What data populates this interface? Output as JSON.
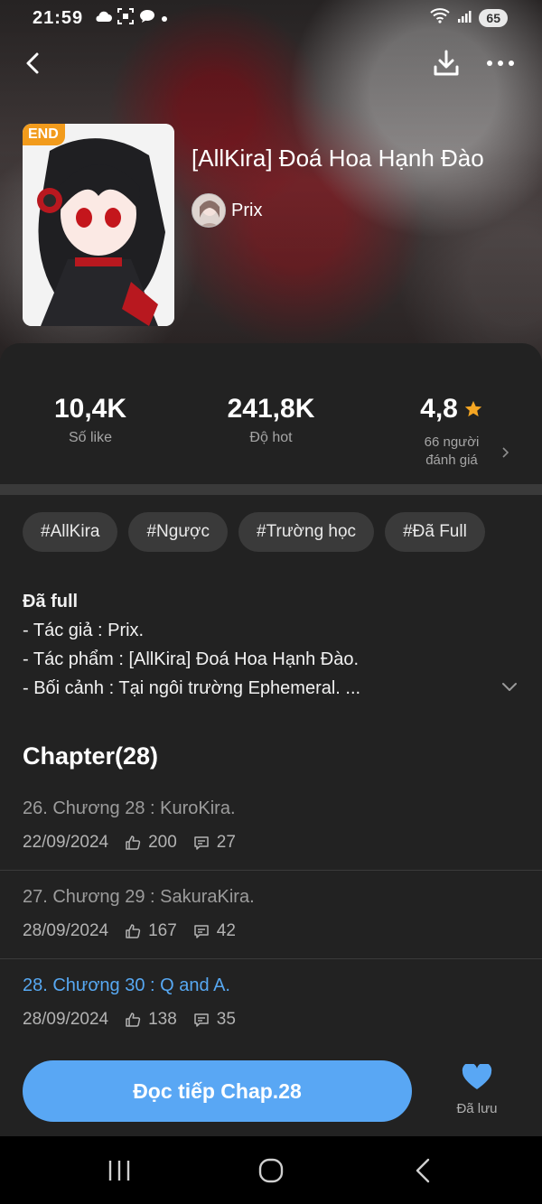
{
  "status_bar": {
    "time": "21:59",
    "battery": "65",
    "icons": [
      "cloud-icon",
      "screenshot-icon",
      "chat-bubble-icon",
      "dot-icon",
      "wifi-icon",
      "signal-icon",
      "battery-icon"
    ]
  },
  "app_bar": {
    "back_icon": "chevron-left-icon",
    "download_icon": "download-icon",
    "more_icon": "more-dots-icon"
  },
  "story": {
    "badge": "END",
    "title": "[AllKira] Đoá Hoa Hạnh Đào",
    "author": "Prix"
  },
  "stats": {
    "likes": {
      "value": "10,4K",
      "label": "Số like"
    },
    "hot": {
      "value": "241,8K",
      "label": "Độ hot"
    },
    "rating": {
      "value": "4,8",
      "label_line1": "66 người",
      "label_line2": "đánh giá"
    }
  },
  "tags": [
    "#AllKira",
    "#Ngược",
    "#Trường học",
    "#Đã Full"
  ],
  "description": {
    "heading": "Đã full",
    "lines": [
      "- Tác giả : Prix.",
      "- Tác phẩm : [AllKira] Đoá Hoa Hạnh Đào.",
      "- Bối cảnh : Tại ngôi trường Ephemeral. ..."
    ]
  },
  "chapters": {
    "heading": "Chapter(28)",
    "items": [
      {
        "title": "26. Chương 28 : KuroKira.",
        "date": "22/09/2024",
        "likes": "200",
        "comments": "27"
      },
      {
        "title": "27. Chương 29 : SakuraKira.",
        "date": "28/09/2024",
        "likes": "167",
        "comments": "42"
      },
      {
        "title": "28. Chương 30 : Q and A.",
        "date": "28/09/2024",
        "likes": "138",
        "comments": "35"
      }
    ]
  },
  "actions": {
    "read_label": "Đọc tiếp Chap.28",
    "saved_label": "Đã lưu"
  },
  "colors": {
    "accent": "#59a7f4",
    "active_chapter": "#57a8f2",
    "badge": "#f29b1c",
    "star": "#f5a623"
  }
}
